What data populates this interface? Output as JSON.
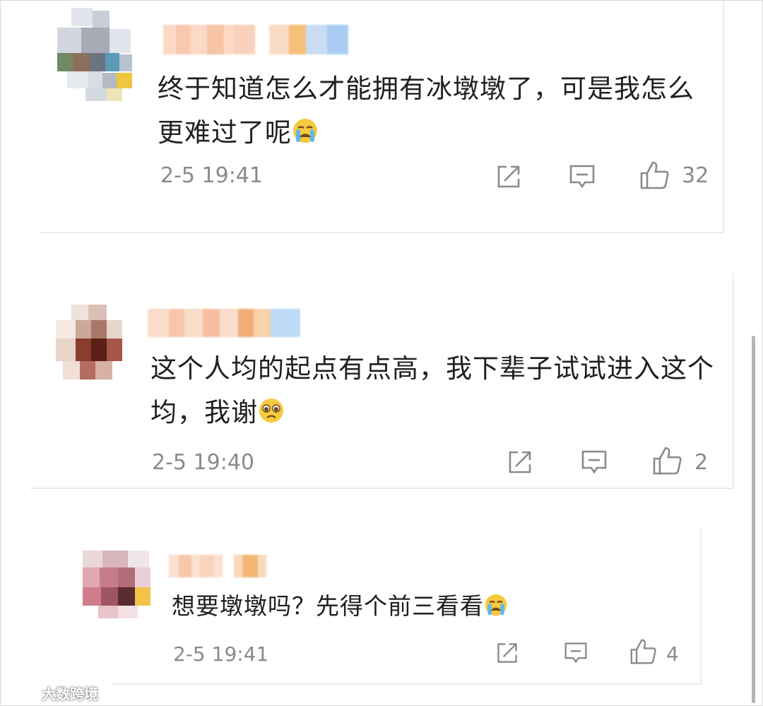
{
  "comments": [
    {
      "text": "终于知道怎么才能拥有冰墩墩了，可是我怎么更难过了呢",
      "emoji": "crying-face",
      "time": "2-5 19:41",
      "likes": "32"
    },
    {
      "text": "这个人均的起点有点高，我下辈子试试进入这个均，我谢",
      "emoji": "pleading-face",
      "time": "2-5 19:40",
      "likes": "2"
    },
    {
      "text": "想要墩墩吗？先得个前三看看",
      "emoji": "crying-face",
      "time": "2-5 19:41",
      "likes": "4"
    }
  ],
  "actions": [
    "share-icon",
    "reply-icon",
    "like-icon"
  ],
  "watermark": {
    "logo": "weibo-logo",
    "text": "大数跨境"
  },
  "colors": {
    "text": "#1f1f1f",
    "meta": "#8a8a8a",
    "divider": "#ebebeb"
  }
}
